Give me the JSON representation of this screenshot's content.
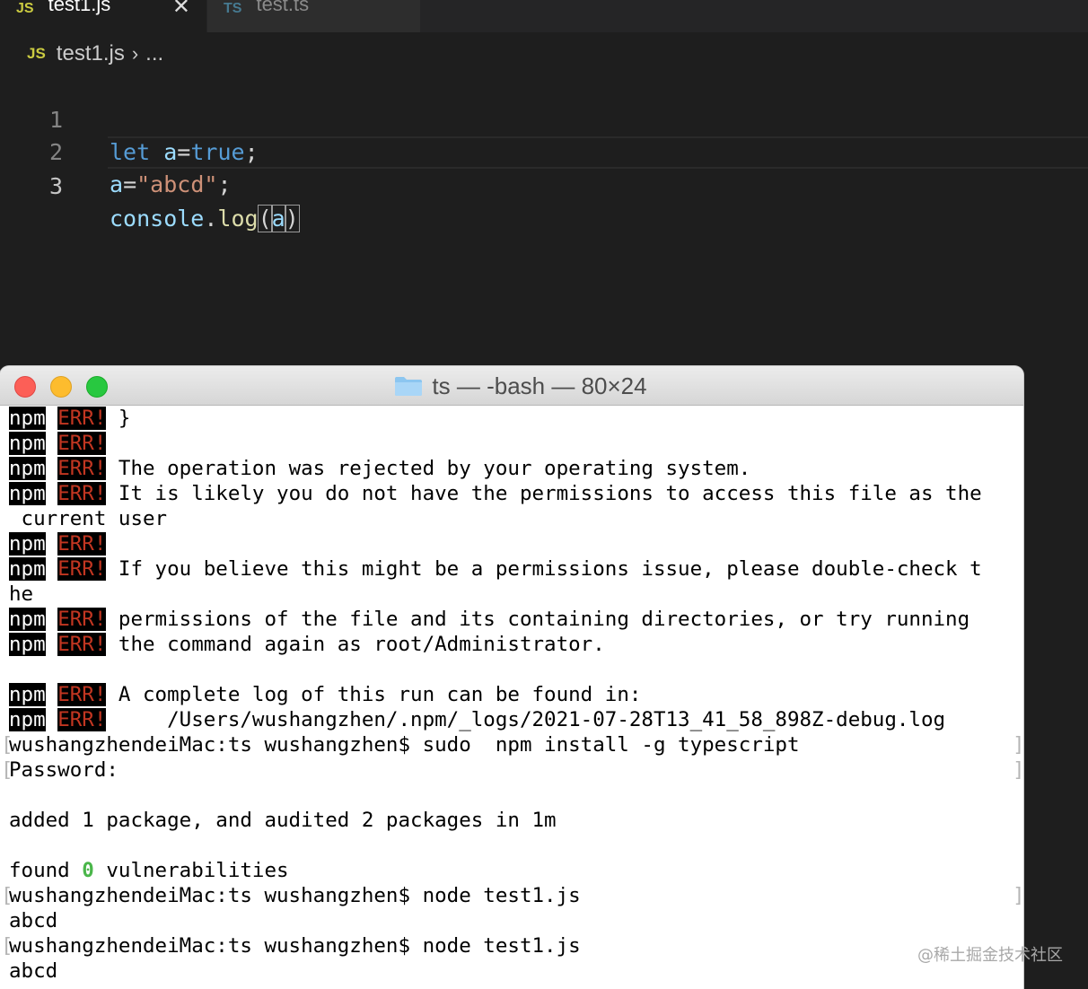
{
  "editor": {
    "tabs": [
      {
        "icon": "JS",
        "label": "test1.js",
        "close": "✕"
      },
      {
        "icon": "TS",
        "label": "test.ts"
      }
    ],
    "breadcrumb": {
      "icon": "JS",
      "file": "test1.js",
      "sep": "›",
      "more": "..."
    },
    "line_numbers": [
      "1",
      "2",
      "3"
    ],
    "code": {
      "line1": {
        "kw": "let",
        "rest_var": "a",
        "eq": "=",
        "val": "true",
        "end": ";"
      },
      "line2": {
        "var": "a",
        "eq": "=",
        "str": "\"abcd\"",
        "end": ";"
      },
      "line3": {
        "obj": "console",
        "dot": ".",
        "fn": "log",
        "open": "(",
        "arg": "a",
        "close": ")"
      }
    }
  },
  "terminal": {
    "title": "ts — -bash — 80×24",
    "npm": "npm",
    "err": "ERR!",
    "lines": {
      "l1": " }",
      "l3": " The operation was rejected by your operating system.",
      "l4": " It is likely you do not have the permissions to access this file as the",
      "l5": " current user",
      "l7": " If you believe this might be a permissions issue, please double-check t",
      "l8": "he",
      "l9": " permissions of the file and its containing directories, or try running",
      "l10": " the command again as root/Administrator.",
      "l12": " A complete log of this run can be found in:",
      "l13": "     /Users/wushangzhen/.npm/_logs/2021-07-28T13_41_58_898Z-debug.log",
      "l14": "wushangzhendeiMac:ts wushangzhen$ sudo  npm install -g typescript",
      "l15": "Password:",
      "l17": "added 1 package, and audited 2 packages in 1m",
      "l19_pre": "found ",
      "l19_num": "0",
      "l19_post": " vulnerabilities",
      "l20": "wushangzhendeiMac:ts wushangzhen$ node test1.js",
      "l21": "abcd",
      "l22": "wushangzhendeiMac:ts wushangzhen$ node test1.js",
      "l23": "abcd",
      "bracket_l": "[",
      "bracket_r": "]"
    }
  },
  "watermark": "@稀土掘金技术社区",
  "colors": {
    "editor_bg": "#1e1e1e",
    "keyword": "#569cd6",
    "variable": "#9cdcfe",
    "string": "#ce9178",
    "function": "#dcdcaa",
    "js_icon": "#cbcb41",
    "ts_icon": "#519aba",
    "err_red": "#c23621",
    "vuln_green": "#4ab64a"
  }
}
